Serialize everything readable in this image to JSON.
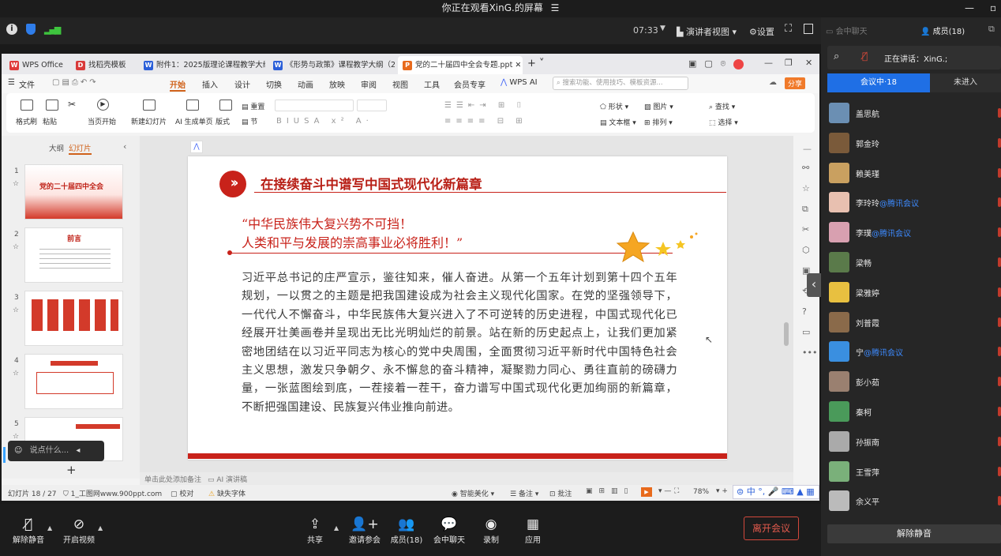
{
  "top": {
    "title": "你正在观看XinG.的屏幕"
  },
  "meeting": {
    "time": "07:33",
    "view": "演讲者视图",
    "settings": "设置"
  },
  "wps_tabs": [
    {
      "label": "WPS Office",
      "color": "#e03a3a"
    },
    {
      "label": "找稻壳模板",
      "color": "#d93a3a"
    },
    {
      "label": "附件1：2025版理论课程教学大纲",
      "color": "#2b5fd9"
    },
    {
      "label": "《形势与政策》课程教学大纲（2024",
      "color": "#2b5fd9"
    },
    {
      "label": "党的二十届四中全会专题.ppt",
      "color": "#e86a1c"
    }
  ],
  "menu": {
    "file": "文件",
    "items": [
      "开始",
      "插入",
      "设计",
      "切换",
      "动画",
      "放映",
      "审阅",
      "视图",
      "工具",
      "会员专享"
    ],
    "wps_ai": "WPS AI",
    "search_placeholder": "搜索功能、使用技巧、模板资源...",
    "share": "分享"
  },
  "ribbon": {
    "format_brush": "格式刷",
    "paste": "粘贴",
    "from_current": "当页开始",
    "new_slide": "新建幻灯片",
    "ai_page": "AI 生成单页",
    "layout": "版式",
    "section": "节",
    "reset": "重置",
    "shape": "形状",
    "picture": "图片",
    "textbox": "文本框",
    "arrange": "排列",
    "find": "查找",
    "select": "选择"
  },
  "sidepanel": {
    "outline": "大纲",
    "slides": "幻灯片"
  },
  "thumbs": [
    {
      "num": "1",
      "title": "党的二十届四中全会"
    },
    {
      "num": "2",
      "title": "前言"
    },
    {
      "num": "3",
      "title": ""
    },
    {
      "num": "4",
      "title": ""
    },
    {
      "num": "5",
      "title": ""
    }
  ],
  "slide": {
    "heading": "在接续奋斗中谱写中国式现代化新篇章",
    "quote1": "“中华民族伟大复兴势不可挡！",
    "quote2": "人类和平与发展的崇高事业必将胜利！”",
    "body": "习近平总书记的庄严宣示，鉴往知来，催人奋进。从第一个五年计划到第十四个五年规划，一以贯之的主题是把我国建设成为社会主义现代化国家。在党的坚强领导下，一代代人不懈奋斗，中华民族伟大复兴进入了不可逆转的历史进程，中国式现代化已经展开壮美画卷并呈现出无比光明灿烂的前景。站在新的历史起点上，让我们更加紧密地团结在以习近平同志为核心的党中央周围，全面贯彻习近平新时代中国特色社会主义思想，激发只争朝夕、永不懈怠的奋斗精神，凝聚勠力同心、勇往直前的磅礴力量，一张蓝图绘到底，一茬接着一茬干，奋力谱写中国式现代化更加绚丽的新篇章，不断把强国建设、民族复兴伟业推向前进。"
  },
  "notes": {
    "placeholder": "单击此处添加备注",
    "ai_speech": "AI 演讲稿"
  },
  "status": {
    "slide": "幻灯片 18 / 27",
    "theme": "1_工图网www.900ppt.com",
    "proof": "校对",
    "font": "缺失字体",
    "beautify": "智能美化",
    "notes": "备注",
    "comment": "批注",
    "zoom": "78%"
  },
  "chat_input": {
    "placeholder": "说点什么..."
  },
  "bottom": {
    "mute": "解除静音",
    "video": "开启视频",
    "share": "共享",
    "invite": "邀请参会",
    "members": "成员(18)",
    "chat": "会中聊天",
    "record": "录制",
    "apps": "应用",
    "leave": "离开会议"
  },
  "panel": {
    "chat_tab": "会中聊天",
    "members_tab": "成员(18)",
    "speaking": "正在讲话：XinG.;",
    "in_meeting": "会议中·18",
    "not_joined": "未进入",
    "unmute_all": "解除静音",
    "members": [
      {
        "name": "盖思航",
        "tag": "",
        "color": "#6b8fb3"
      },
      {
        "name": "郭金玲",
        "tag": "",
        "color": "#7a5a3a"
      },
      {
        "name": "赖美瑾",
        "tag": "",
        "color": "#c9a060"
      },
      {
        "name": "李玲玲",
        "tag": "@腾讯会议",
        "color": "#e8c0b0"
      },
      {
        "name": "李璞",
        "tag": "@腾讯会议",
        "color": "#d8a0b0"
      },
      {
        "name": "梁畅",
        "tag": "",
        "color": "#5a7a4a"
      },
      {
        "name": "梁雅婷",
        "tag": "",
        "color": "#e8c040"
      },
      {
        "name": "刘普霞",
        "tag": "",
        "color": "#8a6a4a"
      },
      {
        "name": "宁",
        "tag": "@腾讯会议",
        "color": "#3a8fe0"
      },
      {
        "name": "彭小茹",
        "tag": "",
        "color": "#9a8070"
      },
      {
        "name": "秦柯",
        "tag": "",
        "color": "#4a9a5a"
      },
      {
        "name": "孙振南",
        "tag": "",
        "color": "#aaaaaa"
      },
      {
        "name": "王雪萍",
        "tag": "",
        "color": "#7ab07a"
      },
      {
        "name": "余义平",
        "tag": "",
        "color": "#bbbbbb"
      }
    ]
  }
}
